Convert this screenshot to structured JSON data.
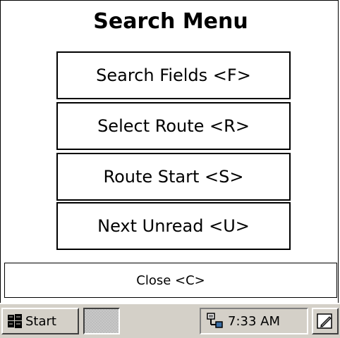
{
  "menu": {
    "title": "Search Menu",
    "buttons": [
      {
        "label": "Search Fields <F>"
      },
      {
        "label": "Select Route <R>"
      },
      {
        "label": "Route Start <S>"
      },
      {
        "label": "Next Unread <U>"
      }
    ],
    "close_label": "Close <C>"
  },
  "taskbar": {
    "start_label": "Start",
    "start_icon": "windows-flag-icon",
    "clock": "7:33 AM",
    "tray_icon": "network-icon",
    "input_icon": "pen-input-icon"
  },
  "colors": {
    "taskbar_bg": "#d4d0c8",
    "window_bg": "#ffffff",
    "border": "#000000"
  }
}
